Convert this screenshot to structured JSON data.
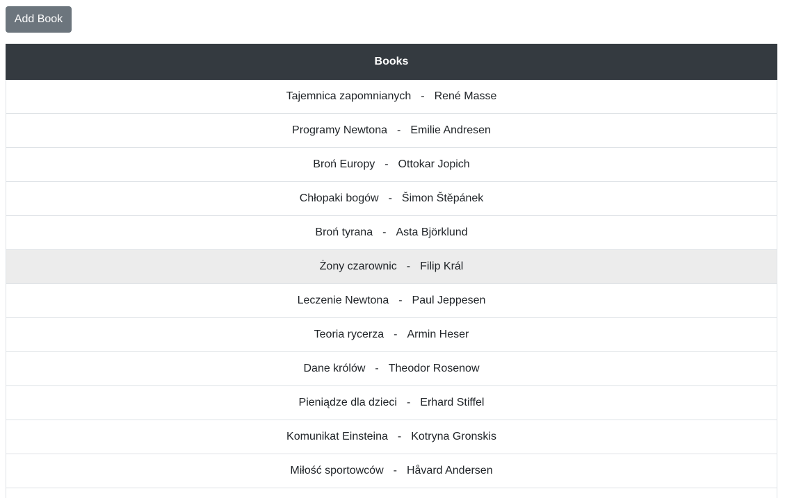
{
  "toolbar": {
    "add_book_label": "Add Book"
  },
  "table": {
    "header": "Books",
    "separator": "-",
    "rows": [
      {
        "title": "Tajemnica zapomnianych",
        "author": "René Masse"
      },
      {
        "title": "Programy Newtona",
        "author": "Emilie Andresen"
      },
      {
        "title": "Broń Europy",
        "author": "Ottokar Jopich"
      },
      {
        "title": "Chłopaki bogów",
        "author": "Šimon Štěpánek"
      },
      {
        "title": "Broń tyrana",
        "author": "Asta Björklund"
      },
      {
        "title": "Żony czarownic",
        "author": "Filip Král",
        "hovered": true
      },
      {
        "title": "Leczenie Newtona",
        "author": "Paul Jeppesen"
      },
      {
        "title": "Teoria rycerza",
        "author": "Armin Heser"
      },
      {
        "title": "Dane królów",
        "author": "Theodor Rosenow"
      },
      {
        "title": "Pieniądze dla dzieci",
        "author": "Erhard Stiffel"
      },
      {
        "title": "Komunikat Einsteina",
        "author": "Kotryna Gronskis"
      },
      {
        "title": "Miłość sportowców",
        "author": "Håvard Andersen"
      },
      {
        "title": "",
        "author": ""
      }
    ]
  },
  "colors": {
    "header_bg": "#343a40",
    "button_bg": "#6c757d",
    "hover_row_bg": "#ececec",
    "border": "#dee2e6"
  }
}
